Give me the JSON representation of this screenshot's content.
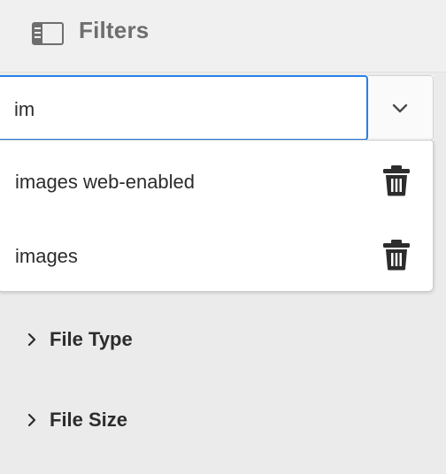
{
  "header": {
    "title": "Filters",
    "icon": "panel-rail-icon"
  },
  "search": {
    "value": "im",
    "toggle_icon": "chevron-down-icon"
  },
  "suggestions": [
    {
      "label": "images web-enabled",
      "action_icon": "trash-icon"
    },
    {
      "label": "images",
      "action_icon": "trash-icon"
    }
  ],
  "facets": [
    {
      "label": "File Type",
      "expanded": false,
      "icon": "chevron-right-icon"
    },
    {
      "label": "File Size",
      "expanded": false,
      "icon": "chevron-right-icon"
    }
  ],
  "colors": {
    "focus": "#2680eb",
    "text": "#2c2c2c",
    "header_text": "#6e6e6e",
    "panel_bg": "#ebebeb"
  }
}
